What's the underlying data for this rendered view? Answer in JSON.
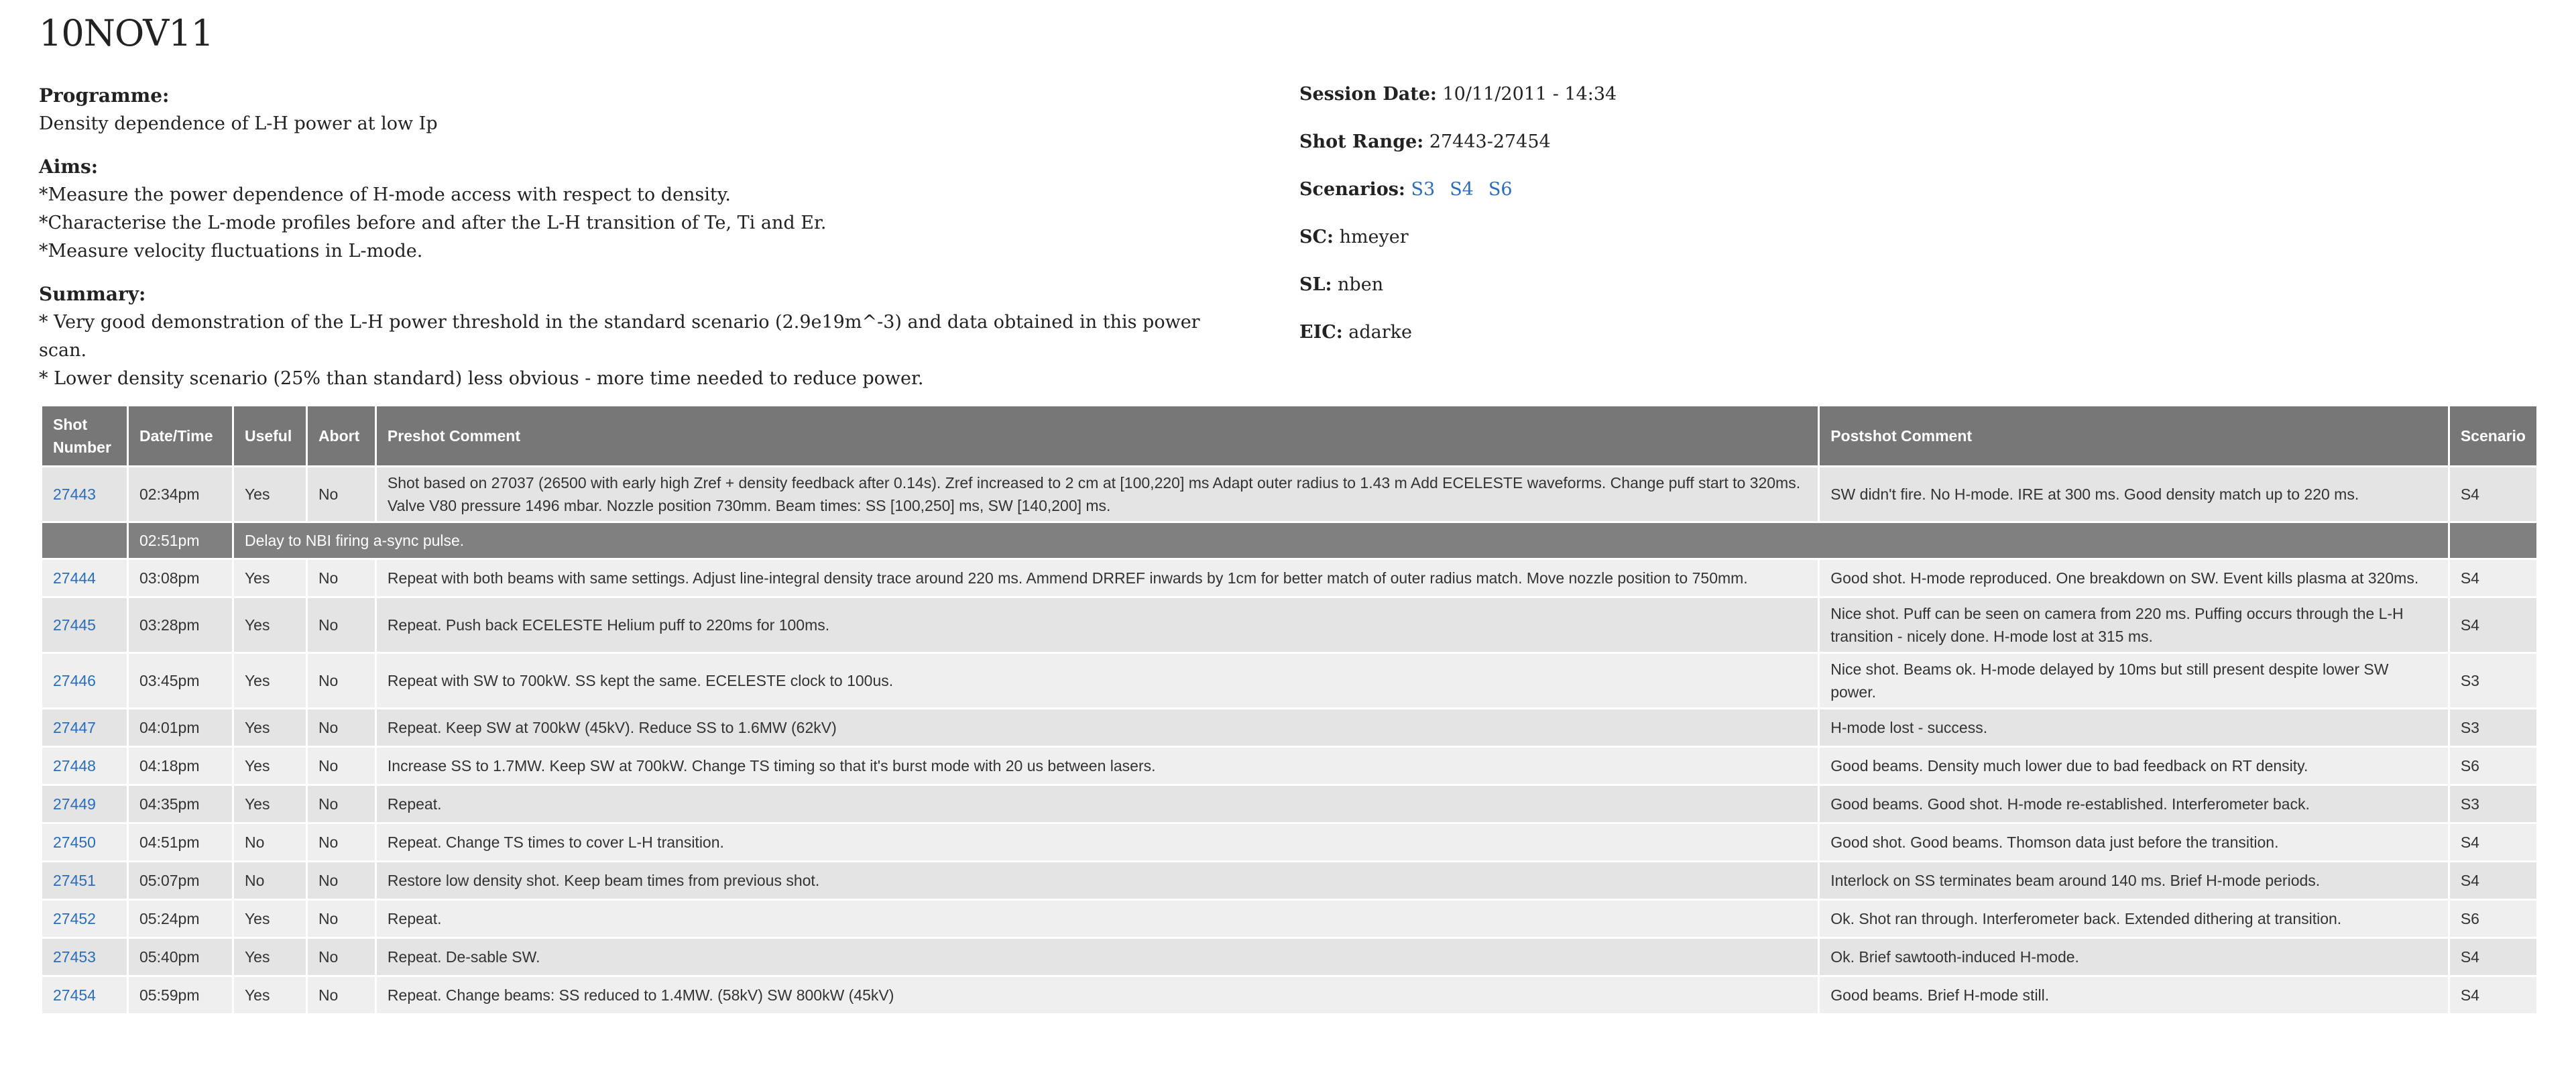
{
  "title": "10NOV11",
  "programme": {
    "label": "Programme:",
    "text": "Density dependence of L-H power at low Ip"
  },
  "aims": {
    "label": "Aims:",
    "items": [
      "*Measure the power dependence of H-mode access with respect to density.",
      "*Characterise the L-mode profiles before and after the L-H transition of Te, Ti and Er.",
      "*Measure velocity fluctuations in L-mode."
    ]
  },
  "summary": {
    "label": "Summary:",
    "items": [
      "* Very good demonstration of the L-H power threshold in the standard scenario (2.9e19m^-3) and data obtained in this power scan.",
      "* Lower density scenario (25% than standard) less obvious - more time needed to reduce power."
    ]
  },
  "session": {
    "date_label": "Session Date:",
    "date": "10/11/2011 - 14:34",
    "range_label": "Shot Range:",
    "range": "27443-27454",
    "scenarios_label": "Scenarios:",
    "scenarios": [
      "S3",
      "S4",
      "S6"
    ],
    "sc_label": "SC:",
    "sc": "hmeyer",
    "sl_label": "SL:",
    "sl": "nben",
    "eic_label": "EIC:",
    "eic": "adarke"
  },
  "colors": {
    "link": "#2a6ebb",
    "header_bg": "#777777",
    "note_bg": "#808080",
    "row_odd": "#e4e4e4",
    "row_even": "#efefef"
  },
  "table": {
    "headers": [
      "Shot Number",
      "Date/Time",
      "Useful",
      "Abort",
      "Preshot Comment",
      "Postshot Comment",
      "Scenario"
    ],
    "rows": [
      {
        "shot": "27443",
        "time": "02:34pm",
        "useful": "Yes",
        "abort": "No",
        "pre": "Shot based on 27037 (26500 with early high Zref + density feedback after 0.14s). Zref increased to 2 cm at [100,220] ms Adapt outer radius to 1.43 m Add ECELESTE waveforms. Change puff start to 320ms. Valve V80 pressure 1496 mbar. Nozzle position 730mm. Beam times: SS [100,250] ms, SW [140,200] ms.",
        "post": "SW didn't fire. No H-mode. IRE at 300 ms. Good density match up to 220 ms.",
        "scenario": "S4"
      },
      {
        "note": true,
        "time": "02:51pm",
        "text": "Delay to NBI firing a-sync pulse."
      },
      {
        "shot": "27444",
        "time": "03:08pm",
        "useful": "Yes",
        "abort": "No",
        "pre": "Repeat with both beams with same settings. Adjust line-integral density trace around 220 ms. Ammend DRREF inwards by 1cm for better match of outer radius match. Move nozzle position to 750mm.",
        "post": "Good shot. H-mode reproduced. One breakdown on SW. Event kills plasma at 320ms.",
        "scenario": "S4"
      },
      {
        "shot": "27445",
        "time": "03:28pm",
        "useful": "Yes",
        "abort": "No",
        "pre": "Repeat. Push back ECELESTE Helium puff to 220ms for 100ms.",
        "post": "Nice shot. Puff can be seen on camera from 220 ms. Puffing occurs through the L-H transition - nicely done. H-mode lost at 315 ms.",
        "scenario": "S4"
      },
      {
        "shot": "27446",
        "time": "03:45pm",
        "useful": "Yes",
        "abort": "No",
        "pre": "Repeat with SW to 700kW. SS kept the same. ECELESTE clock to 100us.",
        "post": "Nice shot. Beams ok. H-mode delayed by 10ms but still present despite lower SW power.",
        "scenario": "S3"
      },
      {
        "shot": "27447",
        "time": "04:01pm",
        "useful": "Yes",
        "abort": "No",
        "pre": "Repeat. Keep SW at 700kW (45kV). Reduce SS to 1.6MW (62kV)",
        "post": "H-mode lost - success.",
        "scenario": "S3"
      },
      {
        "shot": "27448",
        "time": "04:18pm",
        "useful": "Yes",
        "abort": "No",
        "pre": "Increase SS to 1.7MW. Keep SW at 700kW. Change TS timing so that it's burst mode with 20 us between lasers.",
        "post": "Good beams. Density much lower due to bad feedback on RT density.",
        "scenario": "S6"
      },
      {
        "shot": "27449",
        "time": "04:35pm",
        "useful": "Yes",
        "abort": "No",
        "pre": "Repeat.",
        "post": "Good beams. Good shot. H-mode re-established. Interferometer back.",
        "scenario": "S3"
      },
      {
        "shot": "27450",
        "time": "04:51pm",
        "useful": "No",
        "abort": "No",
        "pre": "Repeat. Change TS times to cover L-H transition.",
        "post": "Good shot. Good beams. Thomson data just before the transition.",
        "scenario": "S4"
      },
      {
        "shot": "27451",
        "time": "05:07pm",
        "useful": "No",
        "abort": "No",
        "pre": "Restore low density shot. Keep beam times from previous shot.",
        "post": "Interlock on SS terminates beam around 140 ms. Brief H-mode periods.",
        "scenario": "S4"
      },
      {
        "shot": "27452",
        "time": "05:24pm",
        "useful": "Yes",
        "abort": "No",
        "pre": "Repeat.",
        "post": "Ok. Shot ran through. Interferometer back. Extended dithering at transition.",
        "scenario": "S6"
      },
      {
        "shot": "27453",
        "time": "05:40pm",
        "useful": "Yes",
        "abort": "No",
        "pre": "Repeat. De-sable SW.",
        "post": "Ok. Brief sawtooth-induced H-mode.",
        "scenario": "S4"
      },
      {
        "shot": "27454",
        "time": "05:59pm",
        "useful": "Yes",
        "abort": "No",
        "pre": "Repeat. Change beams: SS reduced to 1.4MW. (58kV) SW 800kW (45kV)",
        "post": "Good beams. Brief H-mode still.",
        "scenario": "S4"
      }
    ]
  }
}
